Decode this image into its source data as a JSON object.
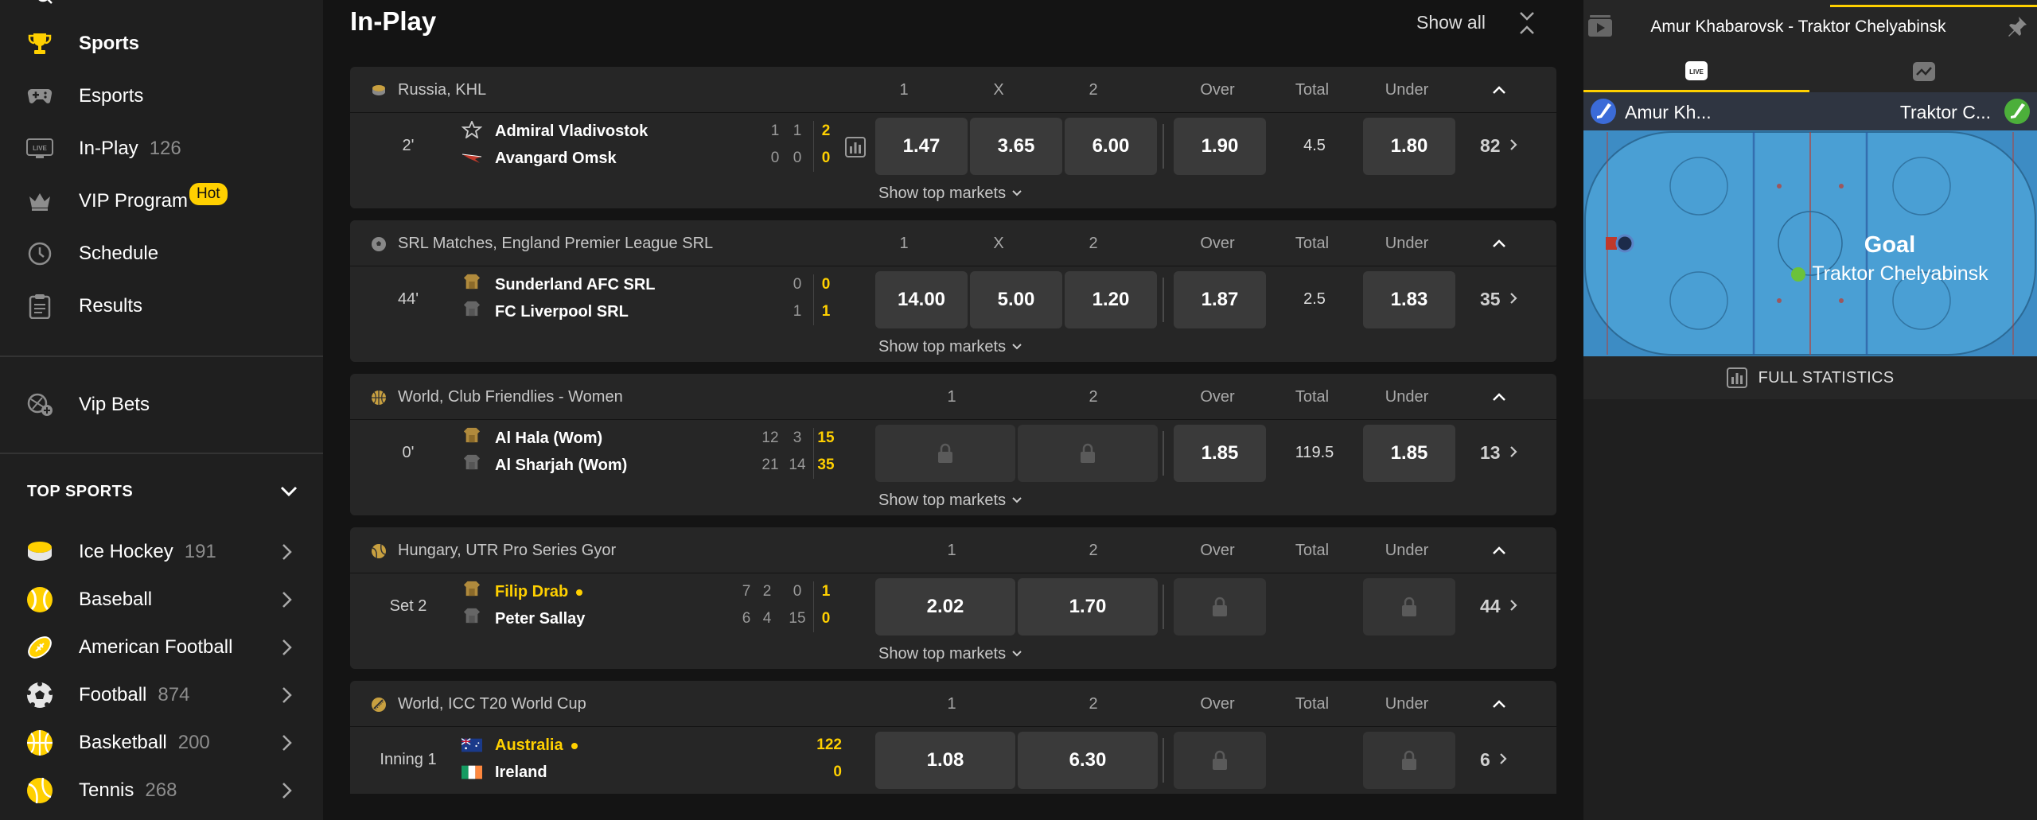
{
  "sidebar": {
    "nav": [
      {
        "label": "Sports",
        "icon": "trophy-icon",
        "active": true
      },
      {
        "label": "Esports",
        "icon": "gamepad-icon"
      },
      {
        "label": "In-Play",
        "count": "126",
        "icon": "live-icon"
      },
      {
        "label": "VIP Program",
        "badge": "Hot",
        "icon": "crown-icon"
      },
      {
        "label": "Schedule",
        "icon": "clock-icon"
      },
      {
        "label": "Results",
        "icon": "clipboard-icon"
      }
    ],
    "vip_bets": {
      "label": "Vip Bets",
      "icon": "vip-bets-icon"
    },
    "top_sports_title": "TOP SPORTS",
    "sports": [
      {
        "label": "Ice Hockey",
        "count": "191",
        "icon": "ice-hockey-icon"
      },
      {
        "label": "Baseball",
        "count": "",
        "icon": "baseball-icon"
      },
      {
        "label": "American Football",
        "count": "",
        "icon": "american-football-icon"
      },
      {
        "label": "Football",
        "count": "874",
        "icon": "football-icon"
      },
      {
        "label": "Basketball",
        "count": "200",
        "icon": "basketball-icon"
      },
      {
        "label": "Tennis",
        "count": "268",
        "icon": "tennis-icon"
      }
    ]
  },
  "main": {
    "title": "In-Play",
    "show_all": "Show all",
    "show_top_markets": "Show top markets",
    "leagues": [
      {
        "name": "Russia, KHL",
        "icon": "ice-hockey-icon",
        "headers": [
          "1",
          "X",
          "2",
          "Over",
          "Total",
          "Under"
        ],
        "match": {
          "time": "2'",
          "home": "Admiral Vladivostok",
          "away": "Avangard Omsk",
          "home_scores": [
            "1",
            "1"
          ],
          "away_scores": [
            "0",
            "0"
          ],
          "home_total": "2",
          "away_total": "0",
          "odds": [
            "1.47",
            "3.65",
            "6.00"
          ],
          "over": "1.90",
          "total": "4.5",
          "under": "1.80",
          "more": "82"
        }
      },
      {
        "name": "SRL Matches, England Premier League SRL",
        "icon": "football-icon",
        "headers": [
          "1",
          "X",
          "2",
          "Over",
          "Total",
          "Under"
        ],
        "match": {
          "time": "44'",
          "home": "Sunderland AFC SRL",
          "away": "FC Liverpool SRL",
          "home_scores": [
            "0"
          ],
          "away_scores": [
            "1"
          ],
          "home_total": "0",
          "away_total": "1",
          "odds": [
            "14.00",
            "5.00",
            "1.20"
          ],
          "over": "1.87",
          "total": "2.5",
          "under": "1.83",
          "more": "35"
        }
      },
      {
        "name": "World, Club Friendlies - Women",
        "icon": "basketball-icon",
        "headers": [
          "1",
          "2",
          "Over",
          "Total",
          "Under"
        ],
        "match": {
          "time": "0'",
          "home": "Al Hala (Wom)",
          "away": "Al Sharjah (Wom)",
          "home_scores": [
            "12",
            "3"
          ],
          "away_scores": [
            "21",
            "14"
          ],
          "home_total": "15",
          "away_total": "35",
          "odds": [
            "",
            ""
          ],
          "over": "1.85",
          "total": "119.5",
          "under": "1.85",
          "more": "13"
        }
      },
      {
        "name": "Hungary, UTR Pro Series Gyor",
        "icon": "tennis-icon",
        "headers": [
          "1",
          "2",
          "Over",
          "Total",
          "Under"
        ],
        "match": {
          "time": "Set 2",
          "home": "Filip Drab",
          "away": "Peter Sallay",
          "home_scores": [
            "7",
            "2",
            "0"
          ],
          "away_scores": [
            "6",
            "4",
            "15"
          ],
          "home_total": "1",
          "away_total": "0",
          "odds": [
            "2.02",
            "1.70"
          ],
          "over": "",
          "total": "",
          "under": "",
          "more": "44"
        }
      },
      {
        "name": "World, ICC T20 World Cup",
        "icon": "cricket-icon",
        "headers": [
          "1",
          "2",
          "Over",
          "Total",
          "Under"
        ],
        "match": {
          "time": "Inning 1",
          "home": "Australia",
          "away": "Ireland",
          "home_total": "122",
          "away_total": "0",
          "odds": [
            "1.08",
            "6.30"
          ],
          "over": "",
          "total": "",
          "under": "",
          "more": "6"
        }
      }
    ]
  },
  "right_panel": {
    "match_title": "Amur Khabarovsk - Traktor Chelyabinsk",
    "home_short": "Amur Kh...",
    "away_short": "Traktor C...",
    "goal_label": "Goal",
    "goal_team": "Traktor Chelyabinsk",
    "full_stats": "FULL STATISTICS",
    "tabs": [
      "live-tab-icon",
      "stats-graph-icon"
    ]
  },
  "colors": {
    "accent": "#ffd000",
    "rink": "#4a9fd4",
    "panel": "#262626",
    "odd_bg": "#3a3a3a"
  }
}
